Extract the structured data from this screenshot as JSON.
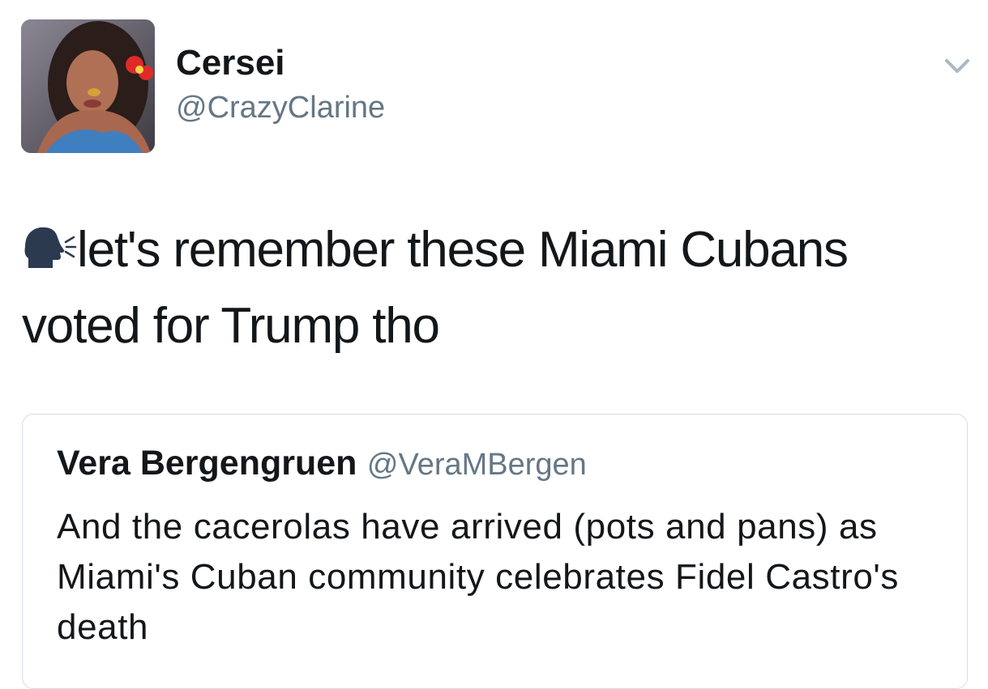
{
  "tweet": {
    "author": {
      "display_name": "Cersei",
      "handle": "@CrazyClarine",
      "avatar_icon": "profile-photo"
    },
    "menu_icon": "chevron-down-icon",
    "leading_emoji": "speaking-head-icon",
    "text": "let's remember these Miami Cubans voted for Trump tho"
  },
  "quoted_tweet": {
    "author": {
      "display_name": "Vera Bergengruen",
      "handle": "@VeraMBergen"
    },
    "text": "And the cacerolas have arrived (pots and pans) as Miami's Cuban community celebrates Fidel Castro's death"
  },
  "colors": {
    "text_primary": "#14171a",
    "text_secondary": "#657786",
    "card_border": "#d6dde3",
    "background": "#ffffff"
  }
}
